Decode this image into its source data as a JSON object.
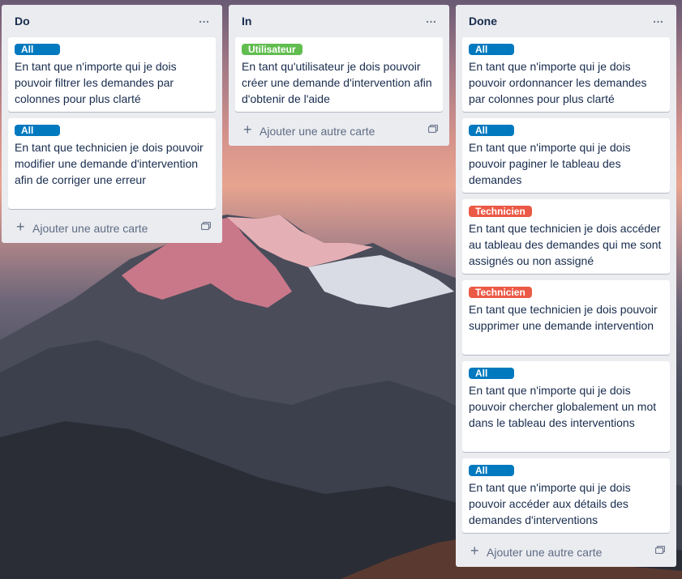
{
  "lists": [
    {
      "title": "Do",
      "menu": "…",
      "cards": [
        {
          "label": "All",
          "label_color": "#0079bf",
          "text": "En tant que n'importe qui je dois pouvoir filtrer les demandes par colonnes pour plus clarté"
        },
        {
          "label": "All",
          "label_color": "#0079bf",
          "text": "En tant que technicien je dois pouvoir modifier une demande d'intervention afin de corriger une erreur"
        }
      ],
      "add_card": "Ajouter une autre carte"
    },
    {
      "title": "In",
      "menu": "…",
      "cards": [
        {
          "label": "Utilisateur",
          "label_color": "#61bd4f",
          "text": "En tant qu'utilisateur je dois pouvoir créer une demande d'intervention afin d'obtenir de l'aide"
        }
      ],
      "add_card": "Ajouter une autre carte"
    },
    {
      "title": "Done",
      "menu": "…",
      "cards": [
        {
          "label": "All",
          "label_color": "#0079bf",
          "text": "En tant que n'importe qui je dois pouvoir ordonnancer les demandes par colonnes pour plus clarté"
        },
        {
          "label": "All",
          "label_color": "#0079bf",
          "text": "En tant que n'importe qui je dois pouvoir paginer le tableau des demandes"
        },
        {
          "label": "Technicien",
          "label_color": "#eb5a46",
          "text": "En tant que technicien je dois accéder au tableau des demandes qui me sont assignés ou non assigné"
        },
        {
          "label": "Technicien",
          "label_color": "#eb5a46",
          "text": "En tant que technicien je dois pouvoir supprimer une demande intervention"
        },
        {
          "label": "All",
          "label_color": "#0079bf",
          "text": "En tant que n'importe qui je dois pouvoir chercher globalement un mot dans le tableau des interventions"
        },
        {
          "label": "All",
          "label_color": "#0079bf",
          "text": "En tant que n'importe qui je dois pouvoir accéder aux détails des demandes d'interventions"
        }
      ],
      "add_card": "Ajouter une autre carte"
    }
  ],
  "icons": {
    "add": "plus-icon",
    "template": "card-template-icon",
    "menu": "more-icon"
  }
}
